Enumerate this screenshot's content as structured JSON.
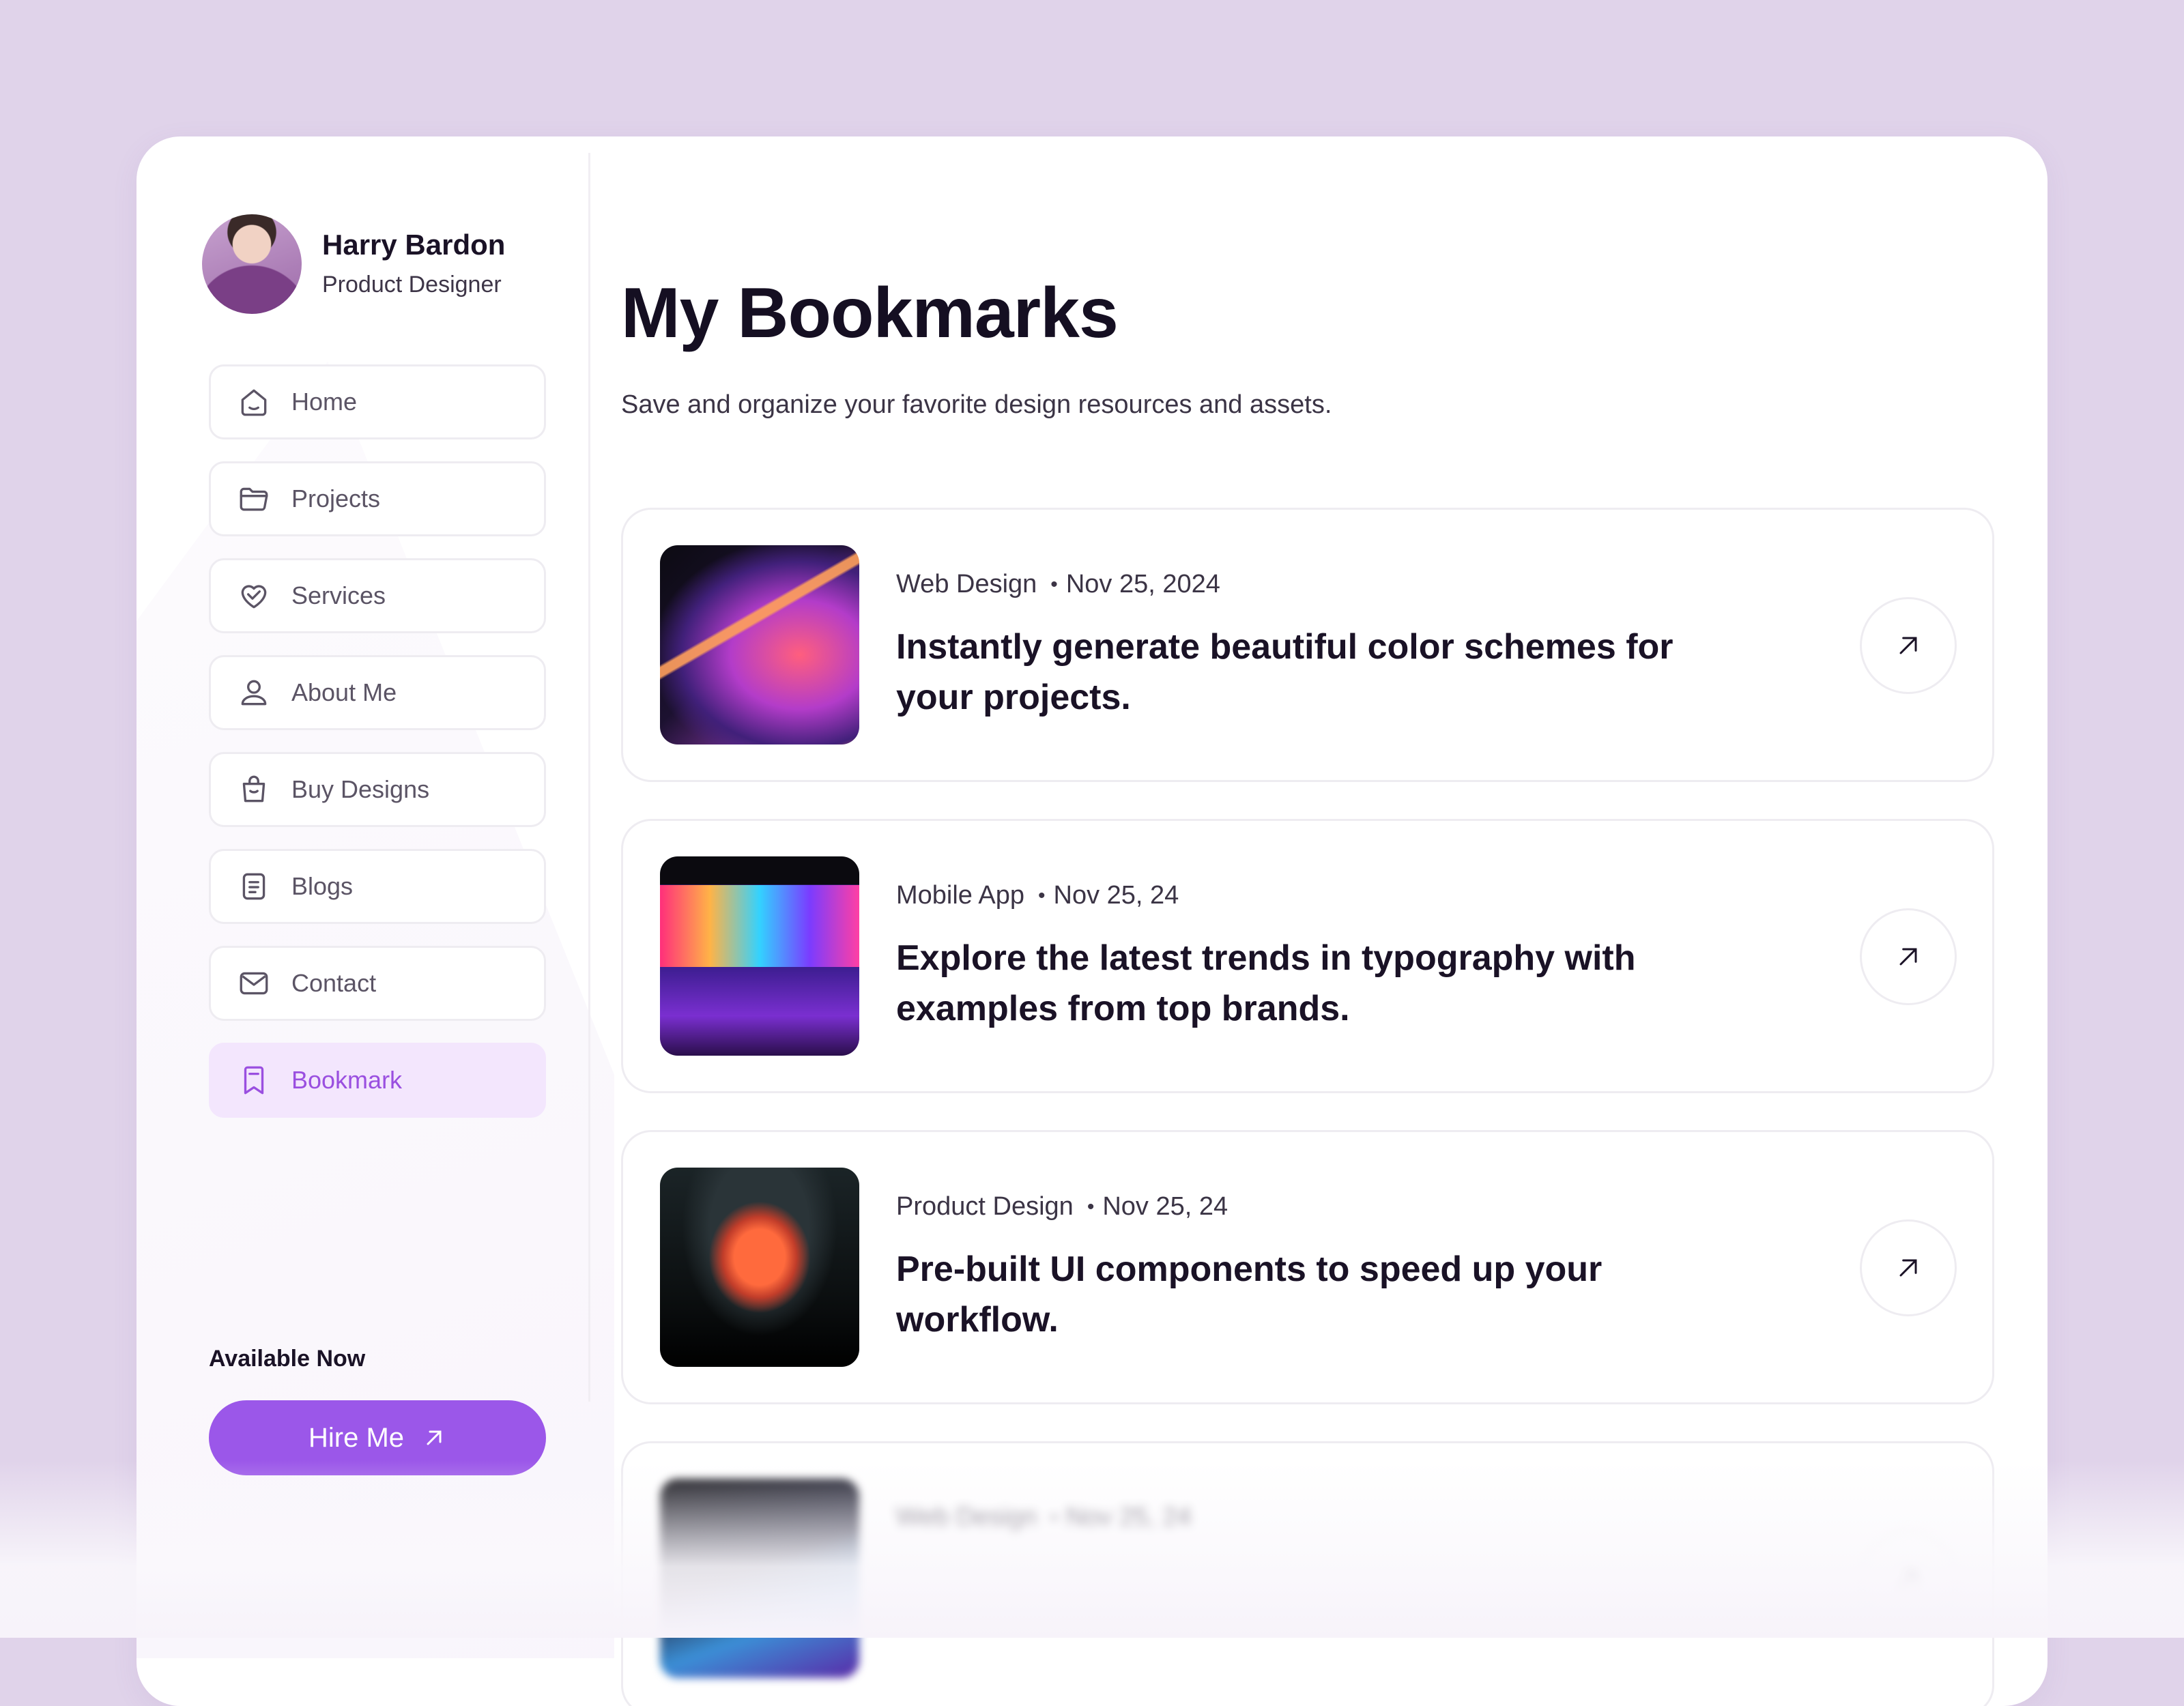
{
  "profile": {
    "name": "Harry Bardon",
    "role": "Product Designer"
  },
  "nav": [
    {
      "label": "Home",
      "icon": "home-icon"
    },
    {
      "label": "Projects",
      "icon": "folder-icon"
    },
    {
      "label": "Services",
      "icon": "heart-handshake-icon"
    },
    {
      "label": "About Me",
      "icon": "user-icon"
    },
    {
      "label": "Buy Designs",
      "icon": "shopping-bag-icon"
    },
    {
      "label": "Blogs",
      "icon": "document-icon"
    },
    {
      "label": "Contact",
      "icon": "mail-icon"
    },
    {
      "label": "Bookmark",
      "icon": "bookmark-icon",
      "active": true
    }
  ],
  "availability": {
    "label": "Available Now",
    "button": "Hire Me"
  },
  "page": {
    "title": "My Bookmarks",
    "subtitle": "Save and organize your favorite design resources and assets."
  },
  "bookmarks": [
    {
      "category": "Web Design",
      "date": "Nov 25, 2024",
      "title": "Instantly generate beautiful color schemes for your projects."
    },
    {
      "category": "Mobile App",
      "date": "Nov 25, 24",
      "title": "Explore the latest trends in typography with examples from top brands."
    },
    {
      "category": "Product Design",
      "date": "Nov 25, 24",
      "title": "Pre-built UI components to speed up your workflow."
    },
    {
      "category": "Web Design",
      "date": "Nov 25, 24",
      "title": ""
    }
  ],
  "colors": {
    "accent": "#9b57e9",
    "active_bg": "#f3e6fd",
    "page_bg": "#e0d3ea"
  }
}
